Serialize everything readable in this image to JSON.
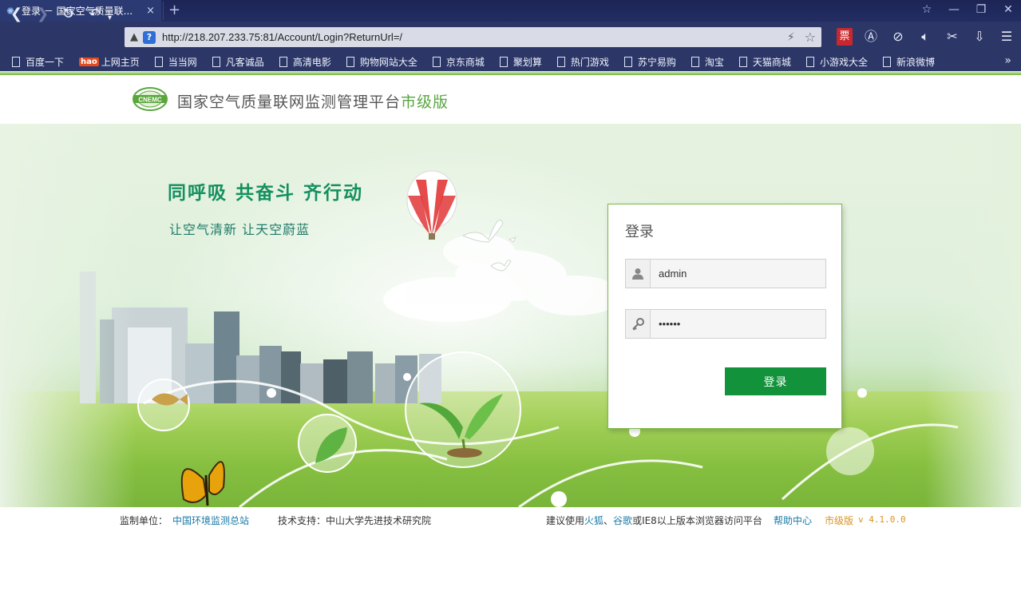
{
  "browser": {
    "tab_title": "登录 － 国家空气质量联...",
    "tab_close": "×",
    "new_tab": "+",
    "address_url": "http://218.207.233.75:81/Account/Login?ReturnUrl=/",
    "tool_piao": "票",
    "bookmarks": [
      {
        "label": "百度一下"
      },
      {
        "label": "上网主页",
        "badge": "hao"
      },
      {
        "label": "当当网"
      },
      {
        "label": "凡客诚品"
      },
      {
        "label": "高清电影"
      },
      {
        "label": "购物网站大全"
      },
      {
        "label": "京东商城"
      },
      {
        "label": "聚划算"
      },
      {
        "label": "热门游戏"
      },
      {
        "label": "苏宁易购"
      },
      {
        "label": "淘宝"
      },
      {
        "label": "天猫商城"
      },
      {
        "label": "小游戏大全"
      },
      {
        "label": "新浪微博"
      }
    ]
  },
  "header": {
    "title_main": "国家空气质量联网监测管理平台",
    "title_version": "市级版",
    "logo_text": "CNEMC"
  },
  "hero": {
    "slogan": "同呼吸  共奋斗  齐行动",
    "subslogan": "让空气清新  让天空蔚蓝"
  },
  "login": {
    "title": "登录",
    "username_value": "admin",
    "password_value": "••••••",
    "submit_label": "登录"
  },
  "footer": {
    "supervisor_label": "监制单位：",
    "supervisor_name": "中国环境监测总站",
    "tech_support": "技术支持：中山大学先进技术研究院",
    "suggest_prefix": "建议使用",
    "browser_firefox": "火狐",
    "separator": "、",
    "browser_chrome": "谷歌",
    "suggest_suffix": "或IE8以上版本浏览器访问平台",
    "help_center": "帮助中心",
    "edition": "市级版",
    "version": "v 4.1.0.0"
  },
  "colors": {
    "brand_green": "#12923a",
    "slogan_green": "#149060",
    "link_blue": "#1a7aa8",
    "version_orange": "#d99222"
  }
}
